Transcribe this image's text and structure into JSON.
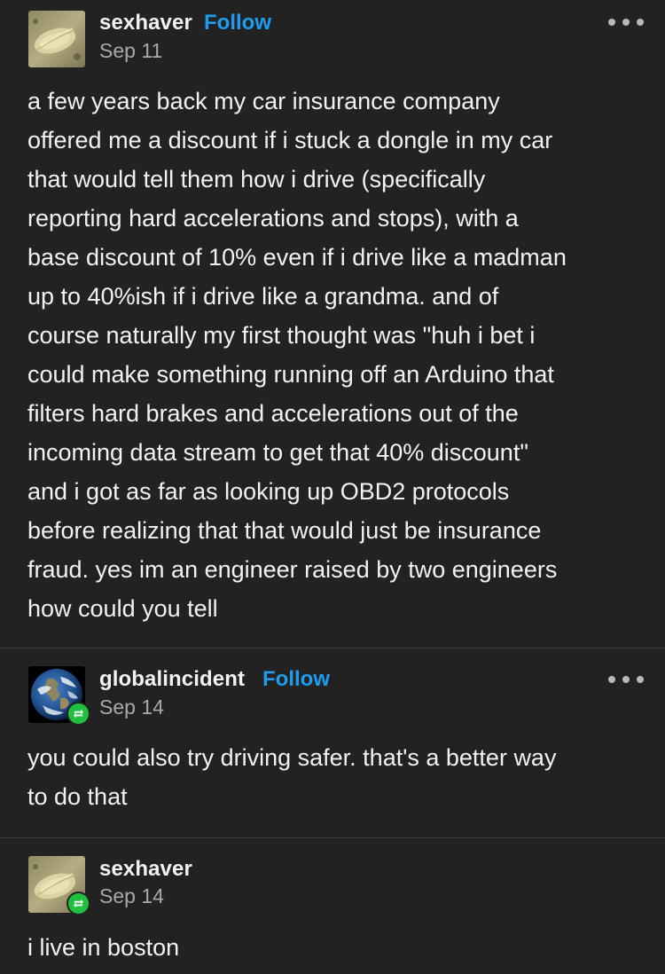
{
  "posts": [
    {
      "username": "sexhaver",
      "follow_label": "Follow",
      "date": "Sep 11",
      "avatar_icon": "beige-textured-avatar",
      "reblogged": false,
      "body_lines": [
        "a few years back my car insurance company",
        "offered me a discount if i stuck a dongle in my car",
        "that would tell them how i drive (specifically",
        "reporting hard accelerations and stops), with a",
        "base discount of 10% even if i drive like a madman",
        "up to 40%ish if i drive like a grandma. and of",
        "course naturally my first thought was \"huh i bet i",
        "could make something running off an Arduino that",
        "filters hard brakes and accelerations out of the",
        "incoming data stream to get that 40% discount\"",
        "and i got as far as looking up OBD2 protocols",
        "before realizing that that would just be insurance",
        "fraud. yes im an engineer raised by two engineers",
        "how could you tell"
      ]
    },
    {
      "username": "globalincident",
      "follow_label": "Follow",
      "date": "Sep 14",
      "avatar_icon": "earth-globe-avatar",
      "reblogged": true,
      "body_lines": [
        "you could also try driving safer. that's a better way",
        "to do that"
      ]
    },
    {
      "username": "sexhaver",
      "date": "Sep 14",
      "avatar_icon": "beige-textured-avatar",
      "reblogged": true,
      "body_lines": [
        "i live in boston"
      ]
    }
  ],
  "icons": {
    "more": "more-options-icon",
    "reblog": "reblog-icon"
  },
  "colors": {
    "background": "#222222",
    "text": "#f2f2f2",
    "secondary_text": "#a8a8a8",
    "follow_link": "#1f9cf0",
    "reblog_badge": "#1fbf3f"
  }
}
